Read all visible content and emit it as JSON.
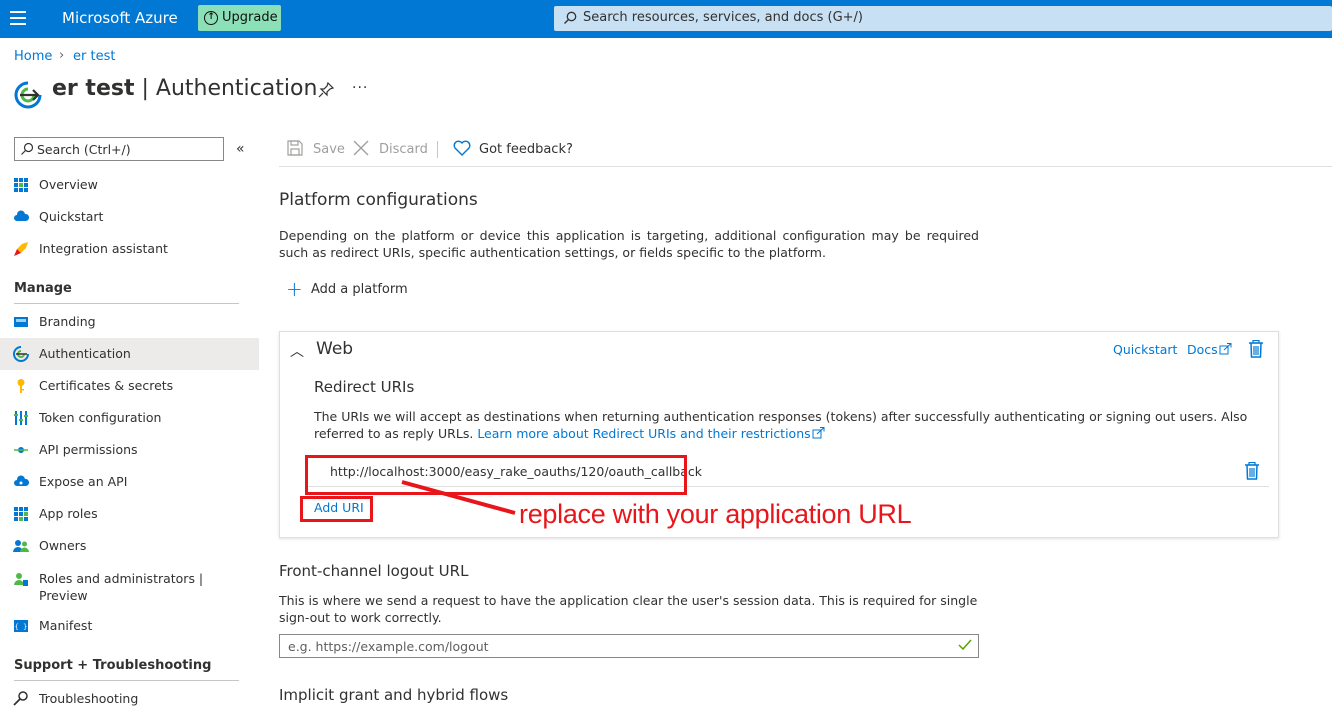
{
  "topbar": {
    "brand": "Microsoft Azure",
    "upgrade_label": "Upgrade",
    "search_placeholder": "Search resources, services, and docs (G+/)"
  },
  "breadcrumb": {
    "home": "Home",
    "separator": ">",
    "app": "er test"
  },
  "header": {
    "app_name": "er test",
    "page_name": "Authentication"
  },
  "sidebar": {
    "search_placeholder": "Search (Ctrl+/)",
    "top_items": [
      {
        "label": "Overview",
        "icon": "grid-icon"
      },
      {
        "label": "Quickstart",
        "icon": "cloud-icon"
      },
      {
        "label": "Integration assistant",
        "icon": "rocket-icon"
      }
    ],
    "manage_title": "Manage",
    "manage_items": [
      {
        "label": "Branding",
        "icon": "branding-icon"
      },
      {
        "label": "Authentication",
        "icon": "authentication-icon",
        "active": true
      },
      {
        "label": "Certificates & secrets",
        "icon": "key-icon"
      },
      {
        "label": "Token configuration",
        "icon": "token-icon"
      },
      {
        "label": "API permissions",
        "icon": "api-permissions-icon"
      },
      {
        "label": "Expose an API",
        "icon": "cloud-api-icon"
      },
      {
        "label": "App roles",
        "icon": "app-roles-icon"
      },
      {
        "label": "Owners",
        "icon": "owners-icon"
      },
      {
        "label": "Roles and administrators | Preview",
        "icon": "roles-admin-icon"
      },
      {
        "label": "Manifest",
        "icon": "manifest-icon"
      }
    ],
    "support_title": "Support + Troubleshooting",
    "support_items": [
      {
        "label": "Troubleshooting",
        "icon": "key-wrench-icon"
      }
    ]
  },
  "commandbar": {
    "save": "Save",
    "discard": "Discard",
    "feedback": "Got feedback?"
  },
  "main": {
    "platform_title": "Platform configurations",
    "platform_desc": "Depending on the platform or device this application is targeting, additional configuration may be required such as redirect URIs, specific authentication settings, or fields specific to the platform.",
    "add_platform": "Add a platform",
    "web": {
      "title": "Web",
      "quickstart": "Quickstart",
      "docs": "Docs",
      "redirect_title": "Redirect URIs",
      "redirect_desc": "The URIs we will accept as destinations when returning authentication responses (tokens) after successfully authenticating or signing out users. Also referred to as reply URLs.",
      "redirect_link": "Learn more about Redirect URIs and their restrictions",
      "uri": "http://localhost:3000/easy_rake_oauths/120/oauth_callback",
      "add_uri": "Add URI"
    },
    "annotation": "replace with your application URL",
    "front_title": "Front-channel logout URL",
    "front_desc": "This is where we send a request to have the application clear the user's session data. This is required for single sign-out to work correctly.",
    "front_placeholder": "e.g. https://example.com/logout",
    "implicit_title": "Implicit grant and hybrid flows"
  },
  "colors": {
    "brand_blue": "#0078d4",
    "upgrade_green": "#8be0b8",
    "annotation_red": "#e8161b"
  }
}
